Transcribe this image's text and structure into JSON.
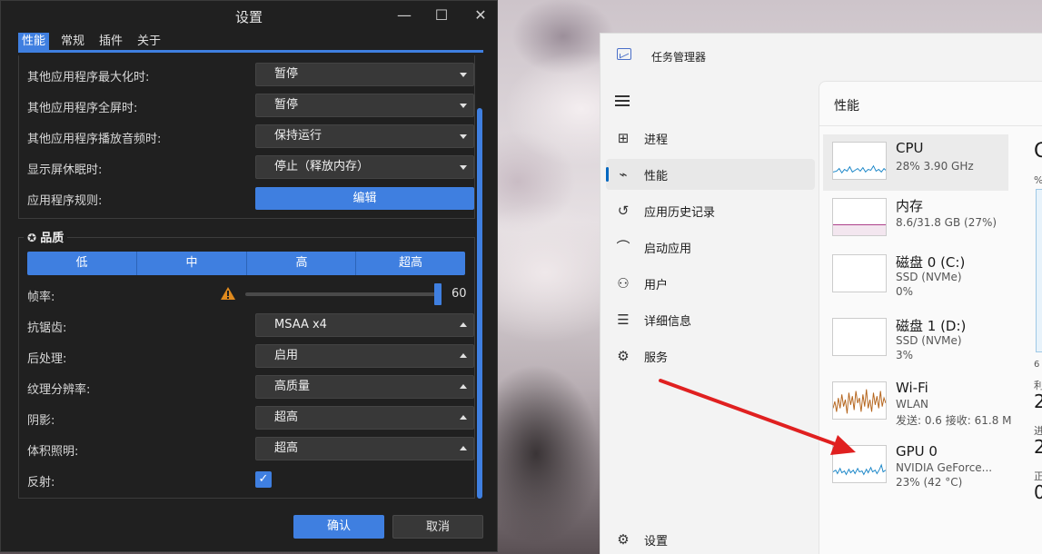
{
  "settings": {
    "title": "设置",
    "tabs": [
      "性能",
      "常规",
      "插件",
      "关于"
    ],
    "rows_top": [
      {
        "label": "其他应用程序最大化时:",
        "value": "暂停"
      },
      {
        "label": "其他应用程序全屏时:",
        "value": "暂停"
      },
      {
        "label": "其他应用程序播放音频时:",
        "value": "保持运行"
      },
      {
        "label": "显示屏休眠时:",
        "value": "停止（释放内存）"
      }
    ],
    "app_rules_label": "应用程序规则:",
    "app_rules_button": "编辑",
    "quality_title": "品质",
    "quality_levels": [
      "低",
      "中",
      "高",
      "超高"
    ],
    "fps_label": "帧率:",
    "fps_value": "60",
    "fps_fraction": 1.0,
    "rows_quality": [
      {
        "label": "抗锯齿:",
        "value": "MSAA x4"
      },
      {
        "label": "后处理:",
        "value": "启用"
      },
      {
        "label": "纹理分辨率:",
        "value": "高质量"
      },
      {
        "label": "阴影:",
        "value": "超高"
      },
      {
        "label": "体积照明:",
        "value": "超高"
      }
    ],
    "reflection_label": "反射:",
    "reflection_checked": true,
    "ok_label": "确认",
    "cancel_label": "取消",
    "accent": "#3f7fe0",
    "warning_color": "#e08a1e"
  },
  "taskmgr": {
    "title": "任务管理器",
    "nav": [
      {
        "label": "进程",
        "icon": "processes-icon"
      },
      {
        "label": "性能",
        "icon": "performance-icon"
      },
      {
        "label": "应用历史记录",
        "icon": "app-history-icon"
      },
      {
        "label": "启动应用",
        "icon": "startup-icon"
      },
      {
        "label": "用户",
        "icon": "users-icon"
      },
      {
        "label": "详细信息",
        "icon": "details-icon"
      },
      {
        "label": "服务",
        "icon": "services-icon"
      }
    ],
    "settings_label": "设置",
    "main_title": "性能",
    "devices": [
      {
        "name": "CPU",
        "line1": "28% 3.90 GHz",
        "line2": "",
        "color": "#1a86c8"
      },
      {
        "name": "内存",
        "line1": "8.6/31.8 GB (27%)",
        "line2": "",
        "color": "#a0257a"
      },
      {
        "name": "磁盘 0 (C:)",
        "line1": "SSD (NVMe)",
        "line2": "0%",
        "color": "#4c9a2a"
      },
      {
        "name": "磁盘 1 (D:)",
        "line1": "SSD (NVMe)",
        "line2": "3%",
        "color": "#4c9a2a"
      },
      {
        "name": "Wi-Fi",
        "line1": "WLAN",
        "line2": "发送: 0.6 接收: 61.8 M",
        "color": "#b5651d"
      },
      {
        "name": "GPU 0",
        "line1": "NVIDIA GeForce...",
        "line2": "23% (42 °C)",
        "color": "#1a86c8"
      }
    ],
    "right_clip_chars": [
      "C",
      "%",
      "",
      "",
      "6",
      "利",
      "2",
      "进",
      "2",
      "正",
      "0"
    ]
  }
}
